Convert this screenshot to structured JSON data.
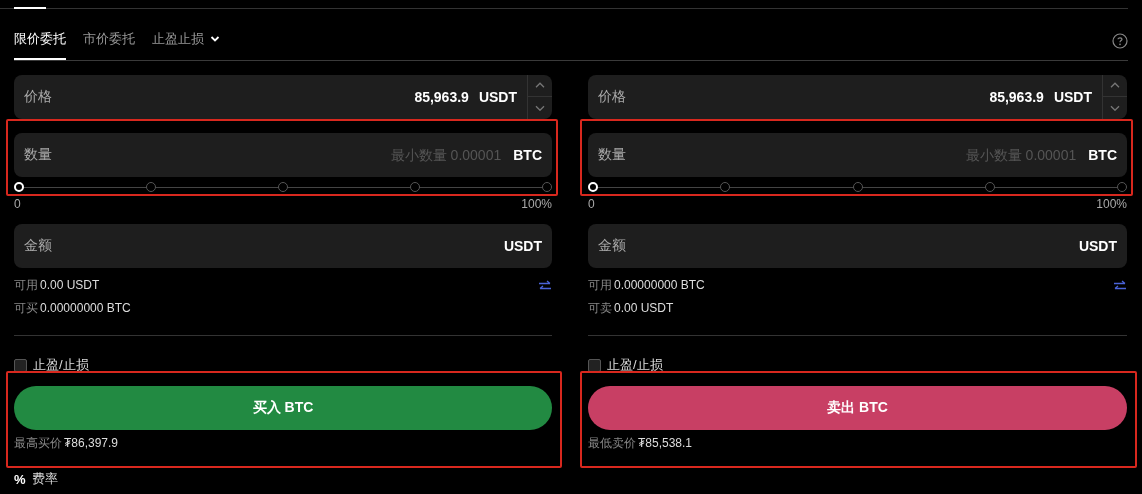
{
  "tabs": [
    {
      "label": "限价委托",
      "selected": true,
      "dropdown": false
    },
    {
      "label": "市价委托",
      "selected": false,
      "dropdown": false
    },
    {
      "label": "止盈止损",
      "selected": false,
      "dropdown": true
    }
  ],
  "panels": [
    {
      "price": {
        "label": "价格",
        "value": "85,963.9",
        "unit": "USDT"
      },
      "quantity": {
        "label": "数量",
        "placeholder": "最小数量 0.00001",
        "unit": "BTC",
        "highlighted": true
      },
      "slider": {
        "level": 0,
        "min_label": "0",
        "max_label": "100%"
      },
      "amount": {
        "label": "金额",
        "unit": "USDT"
      },
      "balances": [
        {
          "label": "可用",
          "value": "0.00 USDT"
        },
        {
          "label": "可买",
          "value": "0.00000000 BTC"
        }
      ],
      "tpsl": {
        "label": "止盈/止损",
        "checked": false
      },
      "action": {
        "label": "买入 BTC",
        "color": "#228a42",
        "highlighted": true
      },
      "best_price": {
        "label": "最高买价",
        "value": "₮86,397.9"
      }
    },
    {
      "price": {
        "label": "价格",
        "value": "85,963.9",
        "unit": "USDT"
      },
      "quantity": {
        "label": "数量",
        "placeholder": "最小数量 0.00001",
        "unit": "BTC",
        "highlighted": true
      },
      "slider": {
        "level": 0,
        "min_label": "0",
        "max_label": "100%"
      },
      "amount": {
        "label": "金额",
        "unit": "USDT"
      },
      "balances": [
        {
          "label": "可用",
          "value": "0.00000000 BTC"
        },
        {
          "label": "可卖",
          "value": "0.00 USDT"
        }
      ],
      "tpsl": {
        "label": "止盈/止损",
        "checked": false
      },
      "action": {
        "label": "卖出 BTC",
        "color": "#c83f64",
        "highlighted": true
      },
      "best_price": {
        "label": "最低卖价",
        "value": "₮85,538.1"
      }
    }
  ],
  "fee": {
    "icon": "%",
    "label": "费率"
  }
}
